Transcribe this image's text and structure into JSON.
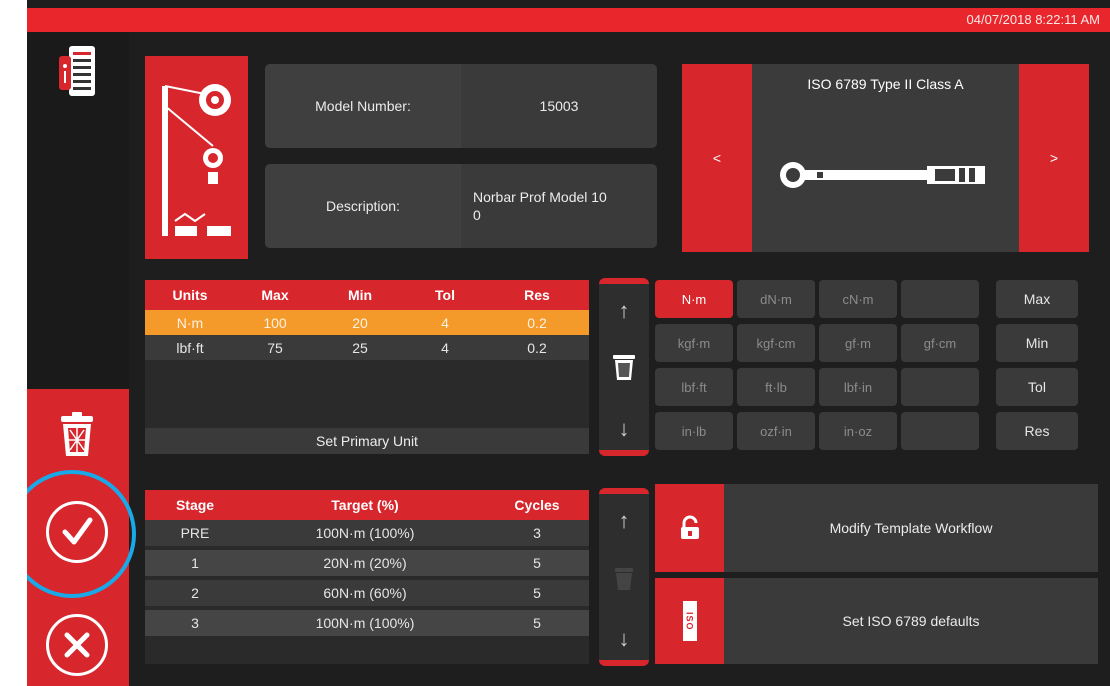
{
  "header": {
    "datetime": "04/07/2018 8:22:11 AM"
  },
  "model": {
    "number_label": "Model Number:",
    "number_value": "15003",
    "description_label": "Description:",
    "description_value": "Norbar Prof Model 10\n0"
  },
  "standard": {
    "title": "ISO 6789 Type II Class A",
    "prev": "<",
    "next": ">"
  },
  "units_table": {
    "headers": [
      "Units",
      "Max",
      "Min",
      "Tol",
      "Res"
    ],
    "rows": [
      [
        "N·m",
        "100",
        "20",
        "4",
        "0.2"
      ],
      [
        "lbf·ft",
        "75",
        "25",
        "4",
        "0.2"
      ]
    ],
    "selected_row": 0,
    "set_primary_label": "Set Primary Unit"
  },
  "unit_grid": [
    [
      "N·m",
      "dN·m",
      "cN·m",
      ""
    ],
    [
      "kgf·m",
      "kgf·cm",
      "gf·m",
      "gf·cm"
    ],
    [
      "lbf·ft",
      "ft·lb",
      "lbf·in",
      ""
    ],
    [
      "in·lb",
      "ozf·in",
      "in·oz",
      ""
    ]
  ],
  "unit_side_buttons": [
    "Max",
    "Min",
    "Tol",
    "Res"
  ],
  "stages_table": {
    "headers": [
      "Stage",
      "Target (%)",
      "Cycles"
    ],
    "rows": [
      [
        "PRE",
        "100N·m (100%)",
        "3"
      ],
      [
        "1",
        "20N·m (20%)",
        "5"
      ],
      [
        "2",
        "60N·m (60%)",
        "5"
      ],
      [
        "3",
        "100N·m (100%)",
        "5"
      ]
    ]
  },
  "actions": {
    "modify_label": "Modify Template Workflow",
    "iso_defaults_label": "Set ISO 6789 defaults",
    "iso_icon_text": "ISO"
  },
  "arrows": {
    "up": "↑",
    "down": "↓"
  },
  "colors": {
    "accent": "#d7262c",
    "selection": "#f39a2b",
    "highlight_ring": "#19a9e8",
    "background": "#1e1e1e"
  }
}
